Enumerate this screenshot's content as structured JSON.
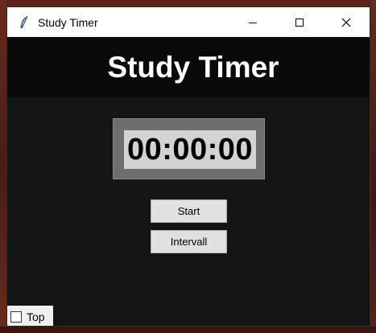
{
  "window": {
    "title": "Study Timer",
    "icon": "feather-icon",
    "controls": [
      "minimize-icon",
      "maximize-icon",
      "close-icon"
    ]
  },
  "header": {
    "title": "Study Timer"
  },
  "timer": {
    "display": "00:00:00"
  },
  "buttons": {
    "start_label": "Start",
    "interval_label": "Intervall"
  },
  "options": {
    "top_label": "Top",
    "top_checked": false
  },
  "colors": {
    "background": "#141414",
    "header_bg": "#090909",
    "timer_frame": "#6e6e6e",
    "timer_bg": "#d3d3d3",
    "button_bg": "#e1e1e1"
  }
}
